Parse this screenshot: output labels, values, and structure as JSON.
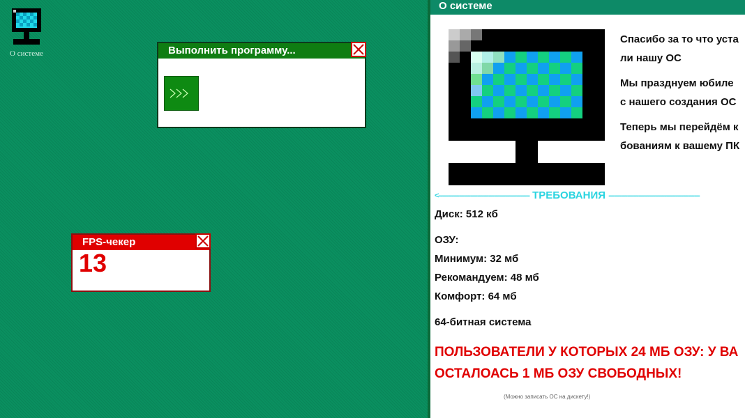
{
  "desktop": {
    "icon_label": "О системе"
  },
  "run_window": {
    "title": "Выполнить программу..."
  },
  "fps_window": {
    "title": "FPS-чекер",
    "value": "13"
  },
  "about_window": {
    "title": "О системе",
    "message_lines": [
      "Спасибо за то что уста",
      "ли нашу ОС",
      "Мы празднуем юбиле",
      "с нашего создания ОС",
      "Теперь мы перейдём к",
      "бованиям к вашему ПК"
    ],
    "requirements_header": "ТРЕБОВАНИЯ",
    "disk": "Диск: 512 кб",
    "ram_label": "ОЗУ:",
    "ram_min": "Минимум: 32 мб",
    "ram_recommended": "Рекомандуем: 48 мб",
    "ram_comfort": "Комфорт: 64 мб",
    "arch": "64-битная система",
    "warning_line1": "ПОЛЬЗОВАТЕЛИ У КОТОРЫХ 24 МБ ОЗУ: У ВА",
    "warning_line2": "ОСТАЛОАСЬ 1 МБ ОЗУ СВОБОДНЫХ!",
    "footnote": "(Можно записать ОС на дискету!)"
  },
  "colors": {
    "desktop_bg": "#0a9060",
    "run_title": "#0f7d12",
    "fps_title": "#e00000",
    "about_title": "#0d8a67",
    "requirements_accent": "#2ad4e0",
    "warning": "#e00000"
  },
  "icons": {
    "desktop_icon": "computer-monitor-icon",
    "close": "close-x-icon",
    "run": "forward-arrows-icon"
  }
}
